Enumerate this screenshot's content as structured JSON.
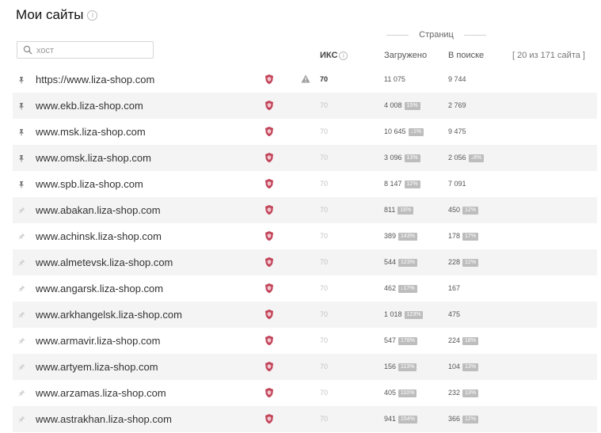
{
  "header": {
    "title": "Мои сайты"
  },
  "search": {
    "placeholder": "хост",
    "value": ""
  },
  "columns": {
    "pages_group": "Страниц",
    "iks": "ИКС",
    "loaded": "Загружено",
    "in_search": "В поиске",
    "count": "[ 20 из 171 сайта ]"
  },
  "colors": {
    "shield": "#c2455a",
    "badge": "#bdbdbd",
    "alt_row": "#f4f4f4"
  },
  "rows": [
    {
      "host": "https://www.liza-shop.com",
      "pinned": true,
      "warning": true,
      "iks": "70",
      "iks_bold": true,
      "loaded": "11 075",
      "loaded_badge": "",
      "in_search": "9 744",
      "search_badge": ""
    },
    {
      "host": "www.ekb.liza-shop.com",
      "pinned": true,
      "warning": false,
      "iks": "70",
      "iks_bold": false,
      "loaded": "4 008",
      "loaded_badge": "15%",
      "in_search": "2 769",
      "search_badge": ""
    },
    {
      "host": "www.msk.liza-shop.com",
      "pinned": true,
      "warning": false,
      "iks": "70",
      "iks_bold": false,
      "loaded": "10 645",
      "loaded_badge": "↓1%",
      "in_search": "9 475",
      "search_badge": ""
    },
    {
      "host": "www.omsk.liza-shop.com",
      "pinned": true,
      "warning": false,
      "iks": "70",
      "iks_bold": false,
      "loaded": "3 096",
      "loaded_badge": "13%",
      "in_search": "2 056",
      "search_badge": "↓8%"
    },
    {
      "host": "www.spb.liza-shop.com",
      "pinned": true,
      "warning": false,
      "iks": "70",
      "iks_bold": false,
      "loaded": "8 147",
      "loaded_badge": "12%",
      "in_search": "7 091",
      "search_badge": ""
    },
    {
      "host": "www.abakan.liza-shop.com",
      "pinned": false,
      "warning": false,
      "iks": "70",
      "iks_bold": false,
      "loaded": "811",
      "loaded_badge": "16%",
      "in_search": "450",
      "search_badge": "12%"
    },
    {
      "host": "www.achinsk.liza-shop.com",
      "pinned": false,
      "warning": false,
      "iks": "70",
      "iks_bold": false,
      "loaded": "389",
      "loaded_badge": "143%",
      "in_search": "178",
      "search_badge": "17%"
    },
    {
      "host": "www.almetevsk.liza-shop.com",
      "pinned": false,
      "warning": false,
      "iks": "70",
      "iks_bold": false,
      "loaded": "544",
      "loaded_badge": "123%",
      "in_search": "228",
      "search_badge": "12%"
    },
    {
      "host": "www.angarsk.liza-shop.com",
      "pinned": false,
      "warning": false,
      "iks": "70",
      "iks_bold": false,
      "loaded": "462",
      "loaded_badge": "↓17%",
      "in_search": "167",
      "search_badge": ""
    },
    {
      "host": "www.arkhangelsk.liza-shop.com",
      "pinned": false,
      "warning": false,
      "iks": "70",
      "iks_bold": false,
      "loaded": "1 018",
      "loaded_badge": "123%",
      "in_search": "475",
      "search_badge": ""
    },
    {
      "host": "www.armavir.liza-shop.com",
      "pinned": false,
      "warning": false,
      "iks": "70",
      "iks_bold": false,
      "loaded": "547",
      "loaded_badge": "178%",
      "in_search": "224",
      "search_badge": "18%"
    },
    {
      "host": "www.artyem.liza-shop.com",
      "pinned": false,
      "warning": false,
      "iks": "70",
      "iks_bold": false,
      "loaded": "156",
      "loaded_badge": "113%",
      "in_search": "104",
      "search_badge": "13%"
    },
    {
      "host": "www.arzamas.liza-shop.com",
      "pinned": false,
      "warning": false,
      "iks": "70",
      "iks_bold": false,
      "loaded": "405",
      "loaded_badge": "110%",
      "in_search": "232",
      "search_badge": "13%"
    },
    {
      "host": "www.astrakhan.liza-shop.com",
      "pinned": false,
      "warning": false,
      "iks": "70",
      "iks_bold": false,
      "loaded": "941",
      "loaded_badge": "154%",
      "in_search": "366",
      "search_badge": "12%"
    }
  ]
}
